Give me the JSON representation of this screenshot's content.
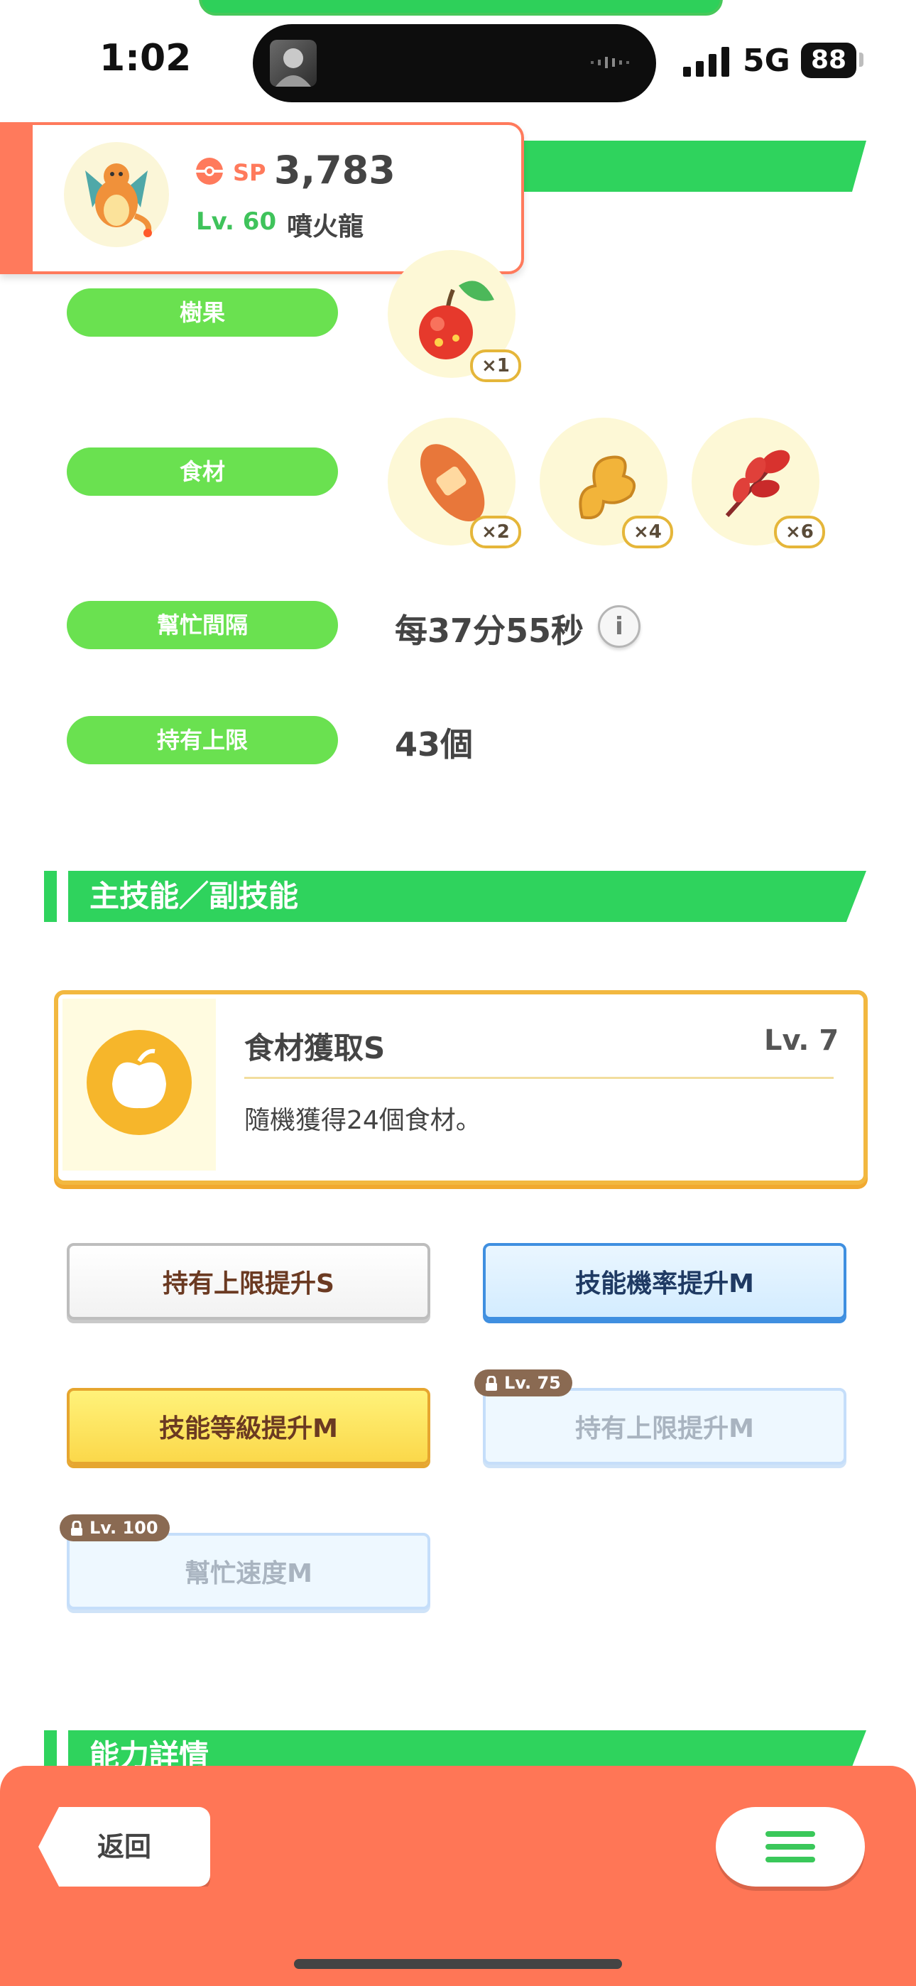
{
  "status_bar": {
    "time": "1:02",
    "network": "5G",
    "battery": "88"
  },
  "pokemon": {
    "sp_label": "SP",
    "sp_value": "3,783",
    "level": "Lv. 60",
    "name": "噴火龍"
  },
  "info": {
    "berry_label": "樹果",
    "berry_qty": "×1",
    "ingredient_label": "食材",
    "ingredients": [
      {
        "icon": "potato-icon",
        "qty": "×2"
      },
      {
        "icon": "ginger-icon",
        "qty": "×4"
      },
      {
        "icon": "herb-icon",
        "qty": "×6"
      }
    ],
    "help_label": "幫忙間隔",
    "help_value": "每37分55秒",
    "cap_label": "持有上限",
    "cap_value": "43個"
  },
  "skills_section": {
    "title": "主技能／副技能"
  },
  "main_skill": {
    "name": "食材獲取S",
    "level": "Lv. 7",
    "description": "隨機獲得24個食材。"
  },
  "sub_skills": [
    {
      "label": "持有上限提升S",
      "style": "white",
      "locked": false
    },
    {
      "label": "技能機率提升M",
      "style": "blue",
      "locked": false
    },
    {
      "label": "技能等級提升M",
      "style": "gold",
      "locked": false
    },
    {
      "label": "持有上限提升M",
      "style": "locked",
      "locked": true,
      "unlock": "Lv. 75"
    },
    {
      "label": "幫忙速度M",
      "style": "locked",
      "locked": true,
      "unlock": "Lv. 100"
    }
  ],
  "next_section": {
    "title": "能力詳情"
  },
  "bottom_bar": {
    "back_label": "返回"
  },
  "colors": {
    "green": "#2fd35d",
    "pill_green": "#6ae150",
    "coral": "#ff7656",
    "gold": "#f2b840"
  }
}
